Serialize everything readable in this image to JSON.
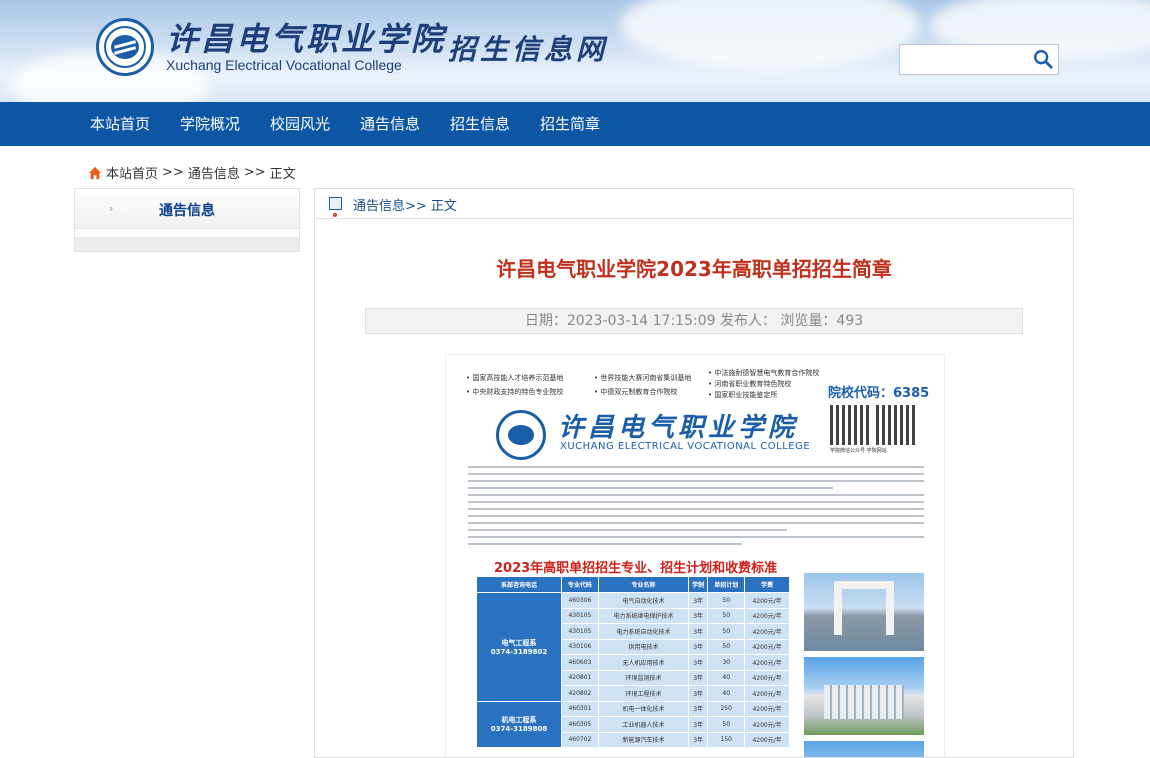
{
  "header": {
    "college_cn": "许昌电气职业学院",
    "college_en": "Xuchang Electrical Vocational College",
    "site_title": "招生信息网",
    "search_placeholder": ""
  },
  "nav": {
    "items": [
      "本站首页",
      "学院概况",
      "校园风光",
      "通告信息",
      "招生信息",
      "招生简章"
    ]
  },
  "breadcrumb": {
    "home": "本站首页",
    "sep1": ">>",
    "section": "通告信息",
    "sep2": ">>",
    "current": "正文"
  },
  "sidebar": {
    "arrow": "›",
    "label": "通告信息"
  },
  "content": {
    "crumb": "通告信息>> 正文",
    "title": "许昌电气职业学院2023年高职单招招生简章",
    "meta": "日期：2023-03-14 17:15:09  发布人：   浏览量：493"
  },
  "poster": {
    "tags": [
      "• 国家高技能人才培养示范基地",
      "• 中央财政支持的特色专业院校",
      "• 世界技能大赛河南省集训基地",
      "• 中德双元制教育合作院校",
      "• 中法施耐德智慧电气教育合作院校",
      "• 河南省职业教育特色院校",
      "• 国家职业技能鉴定所"
    ],
    "school_code": "院校代码：6385",
    "qr_captions": "学院微信公众号      学院网站",
    "cn_name": "许昌电气职业学院",
    "en_name": "XUCHANG ELECTRICAL VOCATIONAL COLLEGE",
    "subtitle": "2023年高职单招招生专业、招生计划和收费标准",
    "table_headers": [
      "系部咨询电话",
      "专业代码",
      "专业名称",
      "学制",
      "单招计划",
      "学费"
    ],
    "groups": [
      {
        "name": "电气工程系",
        "phone": "0374-3189802"
      },
      {
        "name": "机电工程系",
        "phone": "0374-3189808"
      }
    ],
    "rows": [
      [
        "460306",
        "电气自动化技术",
        "3年",
        "50",
        "4200元/年"
      ],
      [
        "430105",
        "电力系统继电保护技术",
        "3年",
        "50",
        "4200元/年"
      ],
      [
        "430105",
        "电力系统自动化技术",
        "3年",
        "50",
        "4200元/年"
      ],
      [
        "430106",
        "供用电技术",
        "3年",
        "50",
        "4200元/年"
      ],
      [
        "460603",
        "无人机应用技术",
        "3年",
        "30",
        "4200元/年"
      ],
      [
        "420801",
        "环境监测技术",
        "3年",
        "40",
        "4200元/年"
      ],
      [
        "420802",
        "环境工程技术",
        "3年",
        "40",
        "4200元/年"
      ],
      [
        "460301",
        "机电一体化技术",
        "3年",
        "250",
        "4200元/年"
      ],
      [
        "460305",
        "工业机器人技术",
        "3年",
        "50",
        "4200元/年"
      ],
      [
        "460702",
        "新能源汽车技术",
        "3年",
        "150",
        "4200元/年"
      ]
    ]
  }
}
